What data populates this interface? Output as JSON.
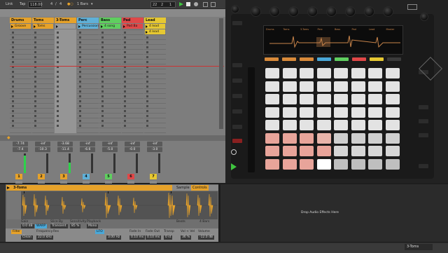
{
  "transport": {
    "link": "Link",
    "tap": "Tap",
    "tempo": "118.00",
    "sig_num": "4",
    "sig_slash": "/",
    "sig_den": "4",
    "metro_dots": "●○",
    "quant": "1 Bars",
    "quant_arrow": "▾",
    "position_bars": "22",
    "position_beats": "2",
    "position_sixteenths": "1"
  },
  "tracks": [
    {
      "name": "Drums",
      "color": "#e6a22a",
      "clip": "Groove",
      "vol": "-7.74",
      "peak": "-7.4",
      "num": "1"
    },
    {
      "name": "Toms",
      "color": "#e6a22a",
      "clip": "Toms",
      "vol": "-inf",
      "peak": "-10.3",
      "num": "2"
    },
    {
      "name": "3-Toms",
      "color": "#e6a22a",
      "clip": "",
      "vol": "-3.68",
      "peak": "-11.4",
      "num": "3"
    },
    {
      "name": "Perc",
      "color": "#5fb0d8",
      "clip": "Percussion",
      "vol": "-inf",
      "peak": "-6.6",
      "num": "4"
    },
    {
      "name": "Bass",
      "color": "#5fcf5f",
      "clip": "4 song",
      "vol": "-inf",
      "peak": "-5.0",
      "num": "5"
    },
    {
      "name": "Pad",
      "color": "#e04848",
      "clip": "Pad Ba",
      "vol": "-inf",
      "peak": "-0.0",
      "num": "6"
    },
    {
      "name": "Lead",
      "color": "#e6c832",
      "clip": "4 lead",
      "clip2": "4 lead",
      "vol": "-inf",
      "peak": "-3.0",
      "num": "7"
    }
  ],
  "detail": {
    "clip_name": "3-Toms",
    "tab_sample": "Sample",
    "tab_controls": "Controls",
    "drop_effects": "Drop Audio Effects Here",
    "gain_label": "Gain",
    "gain_val": "0.0 dB",
    "warp_label": "Transient",
    "sensitivity_label": "Sensitivity",
    "sensitivity_val": "85 %",
    "playback_label": "Playback",
    "playback_val": "Mono",
    "slice_by": "Slice By",
    "filter_label": "Filter",
    "filter_type": "Clean",
    "frequency_label": "Frequency",
    "frequency_val": "22.0 kHz",
    "res_label": "Res",
    "lfo_label": "LFO",
    "lfo_val": "3.00 Hz",
    "fade_in_label": "Fade In",
    "fade_in_val": "0.10 ms",
    "fade_out_label": "Fade Out",
    "fade_out_val": "0.10 ms",
    "transp_label": "Transp",
    "transp_val": "0 st",
    "vol_vel_label": "Vol < Vel",
    "vol_vel_val": "36 %",
    "volume_label": "Volume",
    "volume_val": "-12.0 dB",
    "beats_label": "Beats",
    "bars_label": "4 Bars"
  },
  "push": {
    "screen_labels": [
      "Drums",
      "Toms",
      "3-Toms",
      "Perc",
      "Bass",
      "Pad",
      "Lead",
      "Master"
    ]
  },
  "status": {
    "track": "3-Toms"
  },
  "colors": {
    "accent_orange": "#e6a22a",
    "play_green": "#3fc43f",
    "meter_green": "#2dd24a",
    "record_red": "#c33"
  },
  "icons": [
    "play-icon",
    "stop-icon",
    "record-icon",
    "clip-play-icon",
    "clip-stop-icon"
  ]
}
